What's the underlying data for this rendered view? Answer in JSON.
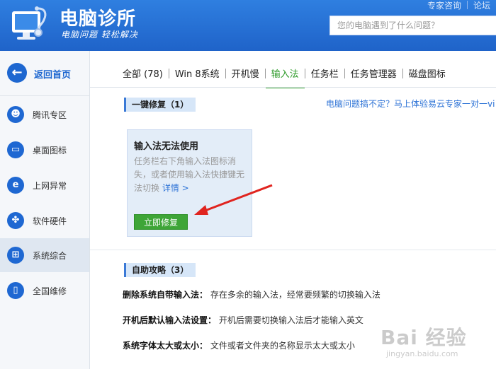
{
  "header": {
    "title": "电脑诊所",
    "slogan": "电脑问题 轻松解决",
    "top_links": [
      "专家咨询",
      "论坛"
    ],
    "search_placeholder": "您的电脑遇到了什么问题？"
  },
  "sidebar": {
    "back_label": "返回首页",
    "items": [
      {
        "label": "腾讯专区",
        "icon": "penguin-icon"
      },
      {
        "label": "桌面图标",
        "icon": "monitor-icon"
      },
      {
        "label": "上网异常",
        "icon": "ie-icon"
      },
      {
        "label": "软件硬件",
        "icon": "puzzle-icon"
      },
      {
        "label": "系统综合",
        "icon": "windows-icon"
      },
      {
        "label": "全国维修",
        "icon": "phone-icon"
      }
    ]
  },
  "tabs": [
    "全部 (78)",
    "Win 8系统",
    "开机慢",
    "输入法",
    "任务栏",
    "任务管理器",
    "磁盘图标"
  ],
  "active_tab": "输入法",
  "quick_fix": {
    "heading": "一键修复（1）",
    "promo": "电脑问题搞不定？马上体验易云专家一对一vi",
    "card_title": "输入法无法使用",
    "card_desc": "任务栏右下角输入法图标消失，或者使用输入法快捷键无法切换",
    "card_link": "详情 >",
    "button": "立即修复"
  },
  "guides": {
    "heading": "自助攻略（3）",
    "items": [
      {
        "title": "删除系统自带输入法：",
        "desc": "存在多余的输入法，经常要频繁的切换输入法"
      },
      {
        "title": "开机后默认输入法设置：",
        "desc": "开机后需要切换输入法后才能输入英文"
      },
      {
        "title": "系统字体太大或太小：",
        "desc": "文件或者文件夹的名称显示太大或太小"
      }
    ]
  },
  "watermark": {
    "text": "Bai 经验",
    "sub": "jingyan.baidu.com"
  },
  "colors": {
    "header": "#2f7fe0",
    "accent_green": "#3ea537",
    "link": "#2c72d6",
    "arrow": "#e0241f"
  }
}
